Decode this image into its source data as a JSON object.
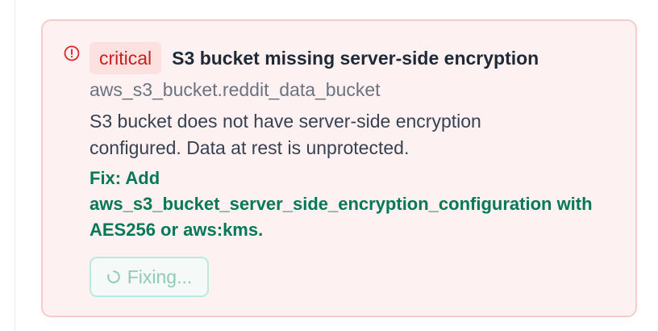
{
  "finding": {
    "severity": "critical",
    "title": "S3 bucket missing server-side encryption",
    "resource": "aws_s3_bucket.reddit_data_bucket",
    "description": "S3 bucket does not have server-side encryption configured. Data at rest is unprotected.",
    "fix": "Fix: Add aws_s3_bucket_server_side_encryption_configuration with AES256 or aws:kms.",
    "action_button": {
      "label": "Fixing...",
      "icon": "spinner-icon",
      "state": "loading"
    }
  },
  "colors": {
    "card_background": "#fef1f1",
    "card_border": "#f8caca",
    "severity_critical": "#c81e1e",
    "fix_text": "#047857",
    "button_border": "#b6ebdd"
  },
  "icons": {
    "alert": "alert-circle-icon"
  }
}
